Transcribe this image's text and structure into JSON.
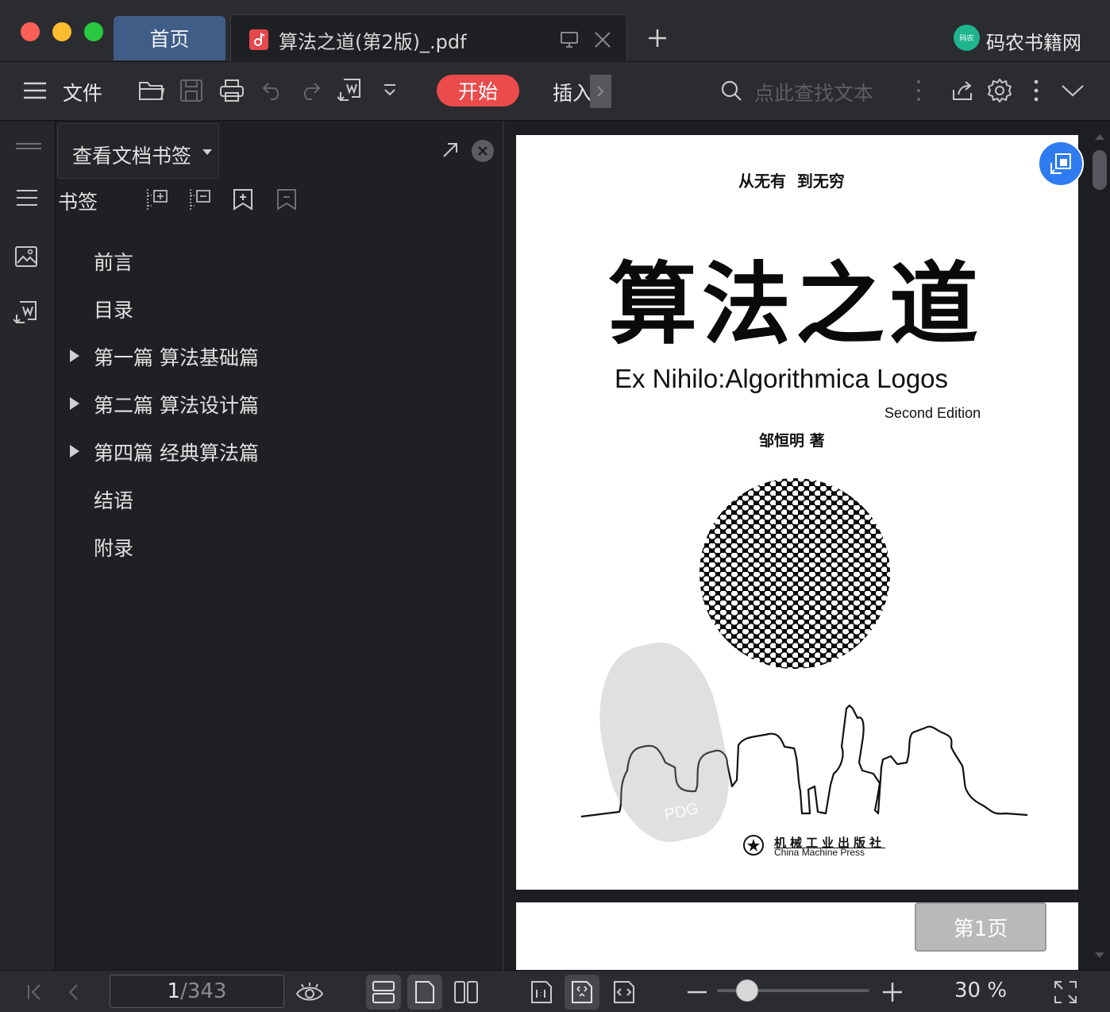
{
  "window": {
    "tabs": [
      {
        "label": "首页"
      },
      {
        "label": "算法之道(第2版)_.pdf"
      }
    ],
    "brand": "码农书籍网",
    "brand_badge": "码农"
  },
  "toolbar": {
    "file_label": "文件",
    "start_label": "开始",
    "insert_label": "插入",
    "search_placeholder": "点此查找文本"
  },
  "panel": {
    "dropdown_label": "查看文档书签",
    "section_label": "书签",
    "bookmarks": [
      {
        "label": "前言",
        "expandable": false
      },
      {
        "label": "目录",
        "expandable": false
      },
      {
        "label": "第一篇 算法基础篇",
        "expandable": true
      },
      {
        "label": "第二篇 算法设计篇",
        "expandable": true
      },
      {
        "label": "第四篇 经典算法篇",
        "expandable": true
      },
      {
        "label": "结语",
        "expandable": false
      },
      {
        "label": "附录",
        "expandable": false
      }
    ]
  },
  "document": {
    "tagline": "从无有  到无穷",
    "title_cn": "算法之道",
    "title_en": "Ex Nihilo:Algorithmica Logos",
    "edition": "Second Edition",
    "author": "邹恒明 著",
    "publisher_cn": "机械工业出版社",
    "publisher_en": "China Machine Press",
    "watermark": "PDG",
    "page_indicator": "第1页"
  },
  "statusbar": {
    "current_page": "1",
    "total_pages": "/343",
    "zoom_label": "30 %",
    "zoom_fraction": 0.2
  },
  "colors": {
    "accent_red": "#ec4b4b",
    "tab_active": "#3f5d86",
    "float_button": "#2f7bf0"
  }
}
